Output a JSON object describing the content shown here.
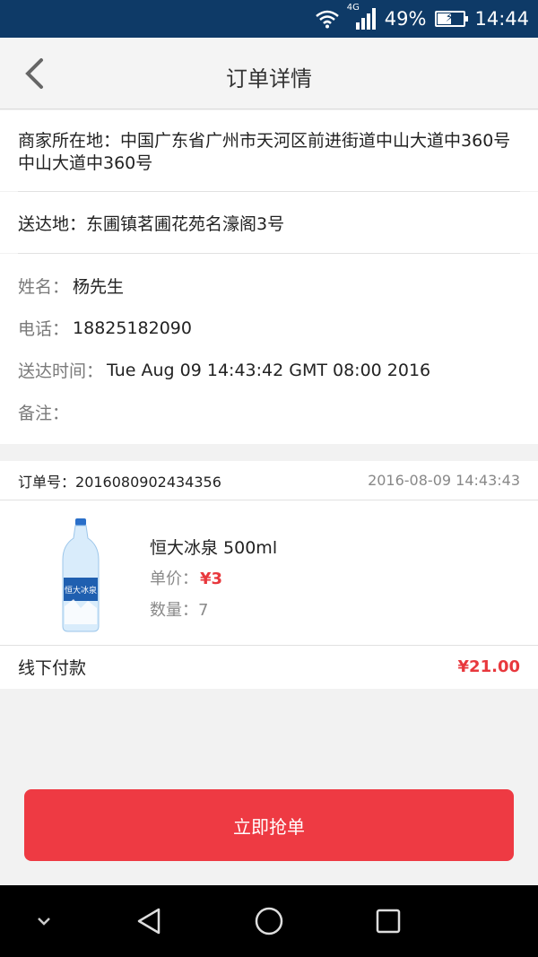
{
  "status_bar": {
    "network": "4G",
    "battery": "49%",
    "time": "14:44"
  },
  "header": {
    "title": "订单详情"
  },
  "merchant": {
    "label": "商家所在地：",
    "address": "中国广东省广州市天河区前进街道中山大道中360号中山大道中360号"
  },
  "delivery": {
    "label": "送达地：",
    "address": "东圃镇茗圃花苑名濠阁3号"
  },
  "contact": {
    "name_label": "姓名：",
    "name": "杨先生",
    "phone_label": "电话：",
    "phone": "18825182090",
    "time_label": "送达时间：",
    "time": "Tue Aug 09 14:43:42 GMT 08:00 2016",
    "note_label": "备注：",
    "note": ""
  },
  "order": {
    "number_label": "订单号：",
    "number": "2016080902434356",
    "created": "2016-08-09 14:43:43",
    "product": {
      "name": "恒大冰泉 500ml",
      "price_label": "单价：",
      "price": "¥3",
      "qty_label": "数量：",
      "qty": "7"
    },
    "payment": "线下付款",
    "total": "¥21.00"
  },
  "actions": {
    "grab_label": "立即抢单"
  },
  "colors": {
    "accent": "#ee3a43",
    "status_bar": "#0e3a67",
    "price": "#e8383d"
  }
}
